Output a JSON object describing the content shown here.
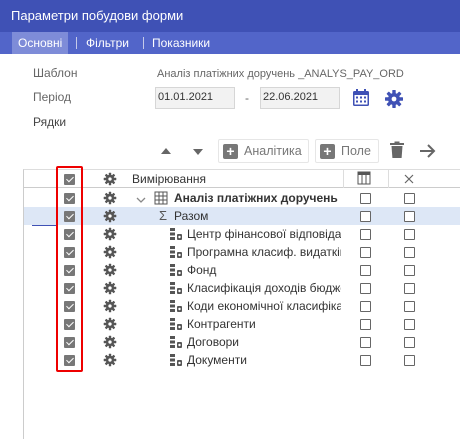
{
  "window": {
    "title": "Параметри побудови форми"
  },
  "tabs": [
    {
      "label": "Основні",
      "active": true
    },
    {
      "label": "Фільтри",
      "active": false
    },
    {
      "label": "Показники",
      "active": false
    }
  ],
  "form": {
    "template_label": "Шаблон",
    "template_value": "Аналіз платіжних доручень _ANALYS_PAY_ORD",
    "period_label": "Період",
    "date_from": "01.01.2021",
    "date_separator": "-",
    "date_to": "22.06.2021",
    "rows_label": "Рядки"
  },
  "toolbar": {
    "analytics_label": "Аналітика",
    "field_label": "Поле"
  },
  "grid": {
    "header": {
      "label": "Вимірювання",
      "col2_icon": "table-columns-icon",
      "col3_icon": "close-icon"
    },
    "rows": [
      {
        "label": "Аналіз платіжних доручень",
        "bold": true,
        "icon": "table-icon",
        "expander": "chevron-down",
        "checked": true,
        "selected": false
      },
      {
        "label": "Разом",
        "bold": false,
        "icon": "sigma-icon",
        "checked": true,
        "selected": true
      },
      {
        "label": "Центр фінансової відповідальності",
        "bold": false,
        "icon": "hierarchy-icon",
        "checked": true,
        "selected": false
      },
      {
        "label": "Програмна класиф. видатків",
        "bold": false,
        "icon": "hierarchy-icon",
        "checked": true,
        "selected": false
      },
      {
        "label": "Фонд",
        "bold": false,
        "icon": "hierarchy-icon",
        "checked": true,
        "selected": false
      },
      {
        "label": "Класифікація доходів бюджету",
        "bold": false,
        "icon": "hierarchy-icon",
        "checked": true,
        "selected": false
      },
      {
        "label": "Коди економічної класифікації",
        "bold": false,
        "icon": "hierarchy-icon",
        "checked": true,
        "selected": false
      },
      {
        "label": "Контрагенти",
        "bold": false,
        "icon": "hierarchy-icon",
        "checked": true,
        "selected": false
      },
      {
        "label": "Договори",
        "bold": false,
        "icon": "hierarchy-icon",
        "checked": true,
        "selected": false
      },
      {
        "label": "Документи",
        "bold": false,
        "icon": "hierarchy-icon",
        "checked": true,
        "selected": false
      }
    ]
  },
  "colors": {
    "titlebar": "#3f51b5",
    "tabbar": "#5265c9",
    "highlight": "#e00000",
    "accent": "#3f51b5"
  }
}
